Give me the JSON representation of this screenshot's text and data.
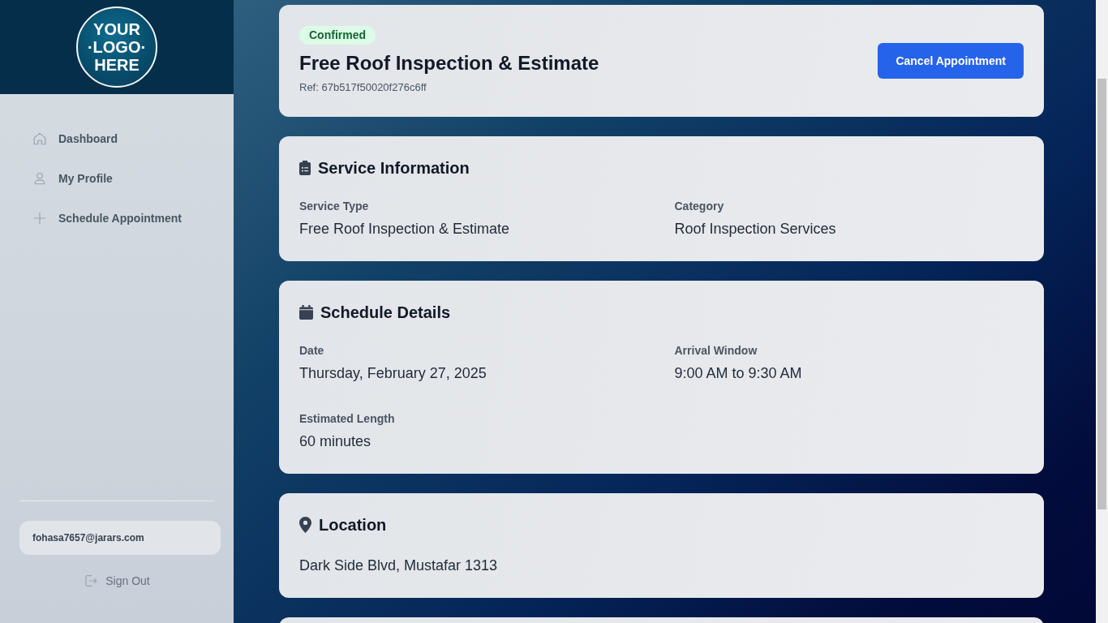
{
  "sidebar": {
    "logo": {
      "lines": [
        "YOUR",
        "·LOGO·",
        "HERE"
      ]
    },
    "nav": [
      {
        "label": "Dashboard",
        "selected": false
      },
      {
        "label": "My Profile",
        "selected": false
      },
      {
        "label": "Schedule Appointment",
        "selected": false
      }
    ],
    "user_email": "fohasa7657@jarars.com",
    "sign_out": "Sign Out"
  },
  "appointment": {
    "status": {
      "label": "Confirmed",
      "kind": "confirmed"
    },
    "title": "Free Roof Inspection & Estimate",
    "ref": "Ref: 67b517f50020f276c6ff",
    "cancel_button": "Cancel Appointment"
  },
  "sections": [
    {
      "kind": "service",
      "title": "Service Information",
      "fields": [
        {
          "label": "Service Type",
          "value": "Free Roof Inspection & Estimate"
        },
        {
          "label": "Category",
          "value": "Roof Inspection Services"
        }
      ]
    },
    {
      "kind": "schedule",
      "title": "Schedule Details",
      "fields": [
        {
          "label": "Date",
          "value": "Thursday, February 27, 2025"
        },
        {
          "label": "Arrival Window",
          "value": "9:00 AM to 9:30 AM"
        },
        {
          "label": "Estimated Length",
          "value": "60 minutes"
        }
      ]
    },
    {
      "kind": "location",
      "title": "Location",
      "fields": [
        {
          "value": "Dark Side Blvd, Mustafar 1313"
        }
      ]
    }
  ]
}
